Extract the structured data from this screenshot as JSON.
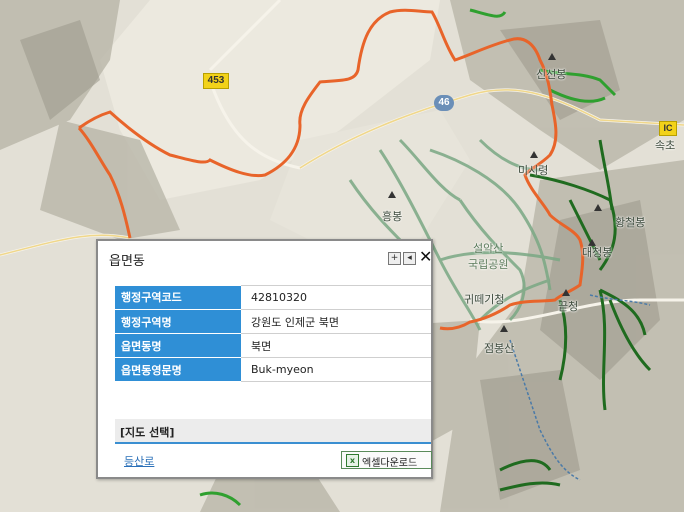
{
  "map": {
    "road_shields": {
      "r453": "453",
      "r46": "46",
      "ic": "IC"
    },
    "places": {
      "sinseonbong": "신선봉",
      "sokcho": "속초",
      "misiryeong": "미시령",
      "hwangcheolbong": "황철봉",
      "ulsanbawi": "울산바위",
      "daecheongbong": "대청봉",
      "seorak_park": "설악산\n국립공원",
      "gwittaegi": "귀떼기청",
      "kkeutcheong": "끝청",
      "jeongbongsan": "점봉산",
      "hyeongbong": "흥봉"
    },
    "colors": {
      "boundary": "#e8642a",
      "trail_dark": "#1f6b1f",
      "trail_light": "#7aa884",
      "trail_green": "#2fa02f"
    }
  },
  "popup": {
    "title": "읍면동",
    "expand_icon": "plus-icon",
    "back_icon": "back-arrow-icon",
    "close_icon": "close-icon",
    "rows": [
      {
        "label": "행정구역코드",
        "value": "42810320"
      },
      {
        "label": "행정구역명",
        "value": "강원도 인제군 북면"
      },
      {
        "label": "읍면동명",
        "value": "북면"
      },
      {
        "label": "읍면동영문명",
        "value": "Buk-myeon"
      }
    ],
    "select_title": "[지도 선택]",
    "trail_link": "등산로",
    "excel_button": "엑셀다운로드",
    "header_color": "#2f8fd6"
  }
}
